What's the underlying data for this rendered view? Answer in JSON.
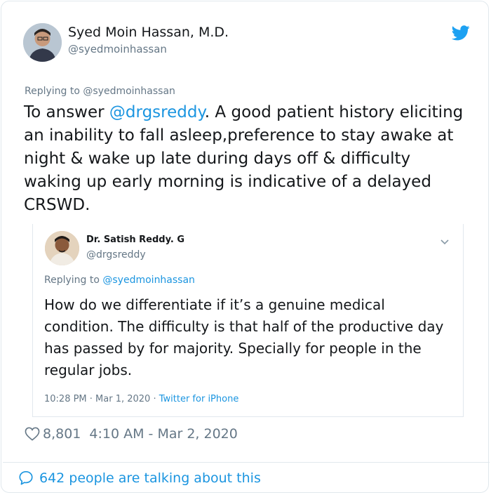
{
  "tweet": {
    "author_name": "Syed Moin Hassan, M.D.",
    "author_handle": "@syedmoinhassan",
    "replying_to": "Replying to @syedmoinhassan",
    "text_prefix": "To answer ",
    "mention": "@drgsreddy",
    "text_rest": ". A good patient history eliciting an inability to fall asleep,preference to stay awake at night & wake up late during days off & difficulty waking up early morning is indicative of a delayed CRSWD.",
    "likes": "8,801",
    "timestamp": "4:10 AM - Mar 2, 2020",
    "talking_text": "642 people are talking about this"
  },
  "quoted": {
    "author_name": "Dr. Satish Reddy. G",
    "author_handle": "@drgsreddy",
    "replying_prefix": "Replying to ",
    "replying_handle": "@syedmoinhassan",
    "text": "How do we differentiate if it’s a genuine medical condition. The difficulty is that half of the productive day has passed by for majority. Specially for people in the regular jobs.",
    "time": "10:28 PM · Mar 1, 2020 · ",
    "source": "Twitter for iPhone"
  },
  "colors": {
    "accent": "#1b95e0",
    "muted": "#657786",
    "border": "#e1e8ed"
  },
  "icons": [
    "twitter-bird-icon",
    "chevron-down-icon",
    "heart-icon",
    "speech-bubble-icon"
  ]
}
